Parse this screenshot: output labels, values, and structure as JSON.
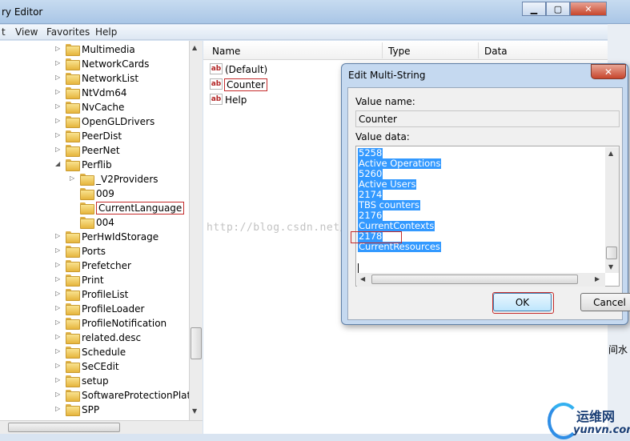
{
  "window": {
    "title": "ry Editor"
  },
  "menu": [
    "t",
    "View",
    "Favorites",
    "Help"
  ],
  "tree": {
    "items": [
      {
        "label": "Multimedia",
        "expanded": false
      },
      {
        "label": "NetworkCards",
        "expanded": false
      },
      {
        "label": "NetworkList",
        "expanded": false
      },
      {
        "label": "NtVdm64",
        "expanded": false
      },
      {
        "label": "NvCache",
        "expanded": false
      },
      {
        "label": "OpenGLDrivers",
        "expanded": false
      },
      {
        "label": "PeerDist",
        "expanded": false
      },
      {
        "label": "PeerNet",
        "expanded": false
      },
      {
        "label": "Perflib",
        "expanded": true
      },
      {
        "label": "_V2Providers",
        "expanded": false,
        "child": true
      },
      {
        "label": "009",
        "child": true
      },
      {
        "label": "CurrentLanguage",
        "child": true,
        "selected": true
      },
      {
        "label": "004",
        "child": true
      },
      {
        "label": "PerHwIdStorage",
        "expanded": false
      },
      {
        "label": "Ports",
        "expanded": false
      },
      {
        "label": "Prefetcher",
        "expanded": false
      },
      {
        "label": "Print",
        "expanded": false
      },
      {
        "label": "ProfileList",
        "expanded": false
      },
      {
        "label": "ProfileLoader",
        "expanded": false
      },
      {
        "label": "ProfileNotification",
        "expanded": false
      },
      {
        "label": "related.desc",
        "expanded": false
      },
      {
        "label": "Schedule",
        "expanded": false
      },
      {
        "label": "SeCEdit",
        "expanded": false
      },
      {
        "label": "setup",
        "expanded": false
      },
      {
        "label": "SoftwareProtectionPlatfo",
        "expanded": false
      },
      {
        "label": "SPP",
        "expanded": false
      }
    ]
  },
  "list": {
    "columns": [
      "Name",
      "Type",
      "Data"
    ],
    "values": [
      "(Default)",
      "Counter",
      "Help"
    ],
    "icon_text": "ab"
  },
  "dialog": {
    "title": "Edit Multi-String",
    "close_label": "✕",
    "value_name_label": "Value name:",
    "value_name": "Counter",
    "value_data_label": "Value data:",
    "value_lines": [
      "5258",
      "Active Operations",
      "5260",
      "Active Users",
      "2174",
      "TBS counters",
      "2176",
      "CurrentContexts",
      "2178",
      "CurrentResources"
    ],
    "ok_label": "OK",
    "cancel_label": "Cancel"
  },
  "watermark": "http://blog.csdn.net/     ldq",
  "edge_text": "间水",
  "logo": {
    "cn": "运维网",
    "en": "yunvn.com"
  },
  "colors": {
    "selection": "#3399ff",
    "highlight_box": "#c42b2b",
    "title_gradient_top": "#c7dbf0"
  }
}
